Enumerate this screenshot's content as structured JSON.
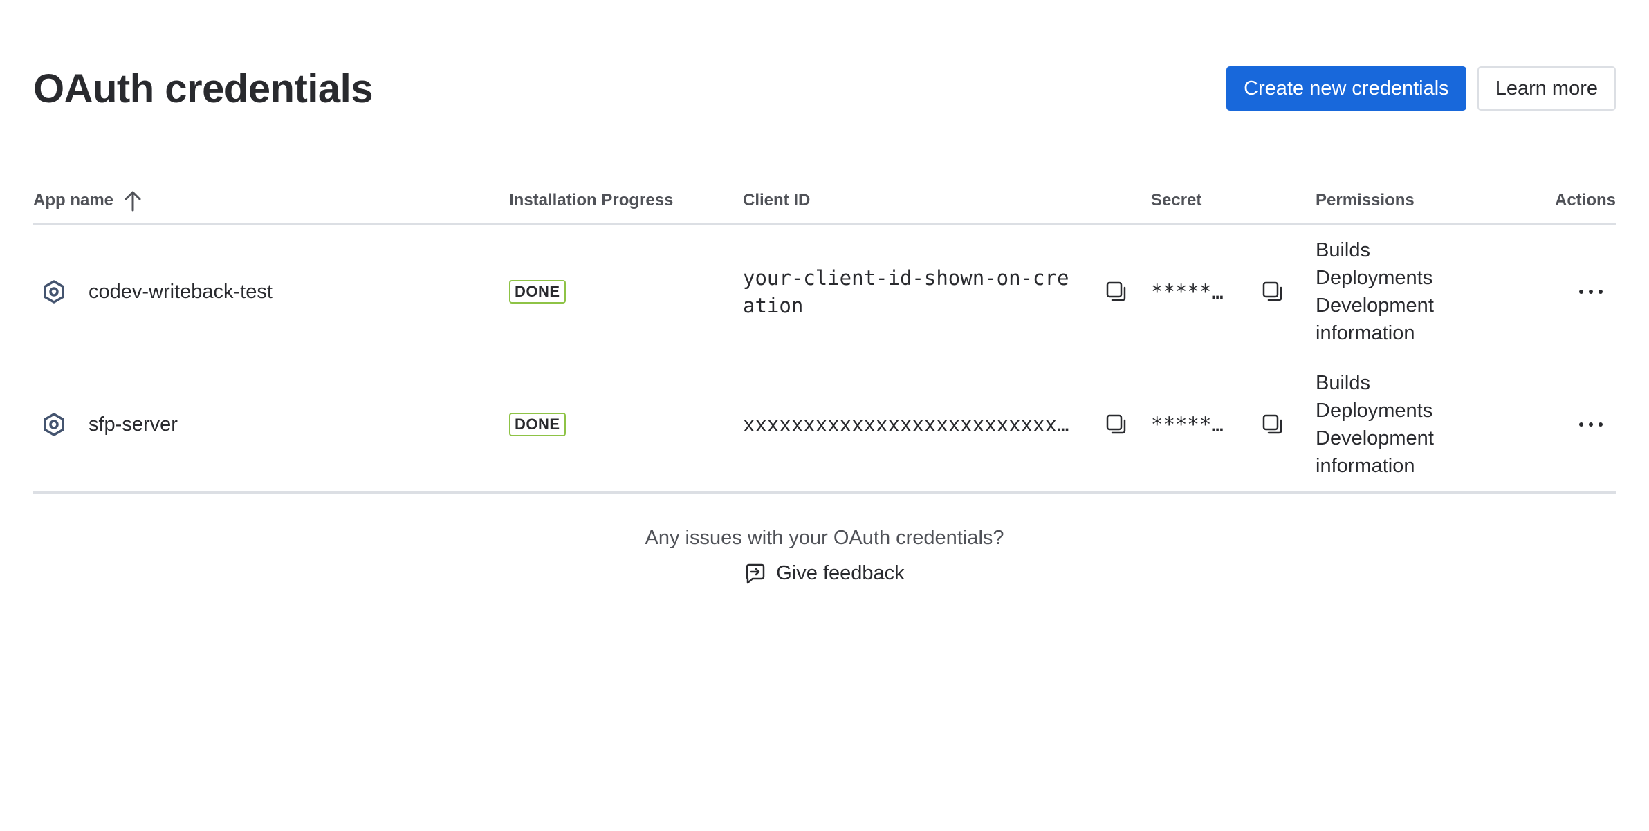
{
  "page": {
    "title": "OAuth credentials"
  },
  "header": {
    "create_label": "Create new credentials",
    "learn_label": "Learn more"
  },
  "table": {
    "columns": [
      "App name",
      "Installation Progress",
      "Client ID",
      "Secret",
      "Permissions",
      "Actions"
    ],
    "rows": [
      {
        "app_name": "codev-writeback-test",
        "progress": "DONE",
        "client_id": "your-client-id-shown-on-creation",
        "secret": "******…",
        "permissions": [
          "Builds",
          "Deployments",
          "Development",
          "information"
        ]
      },
      {
        "app_name": "sfp-server",
        "progress": "DONE",
        "client_id": "xxxxxxxxxxxxxxxxxxxxxxxxxxxxxxxxxxxx",
        "secret": "******…",
        "permissions": [
          "Builds",
          "Deployments",
          "Development",
          "information"
        ]
      }
    ]
  },
  "footer": {
    "question": "Any issues with your OAuth credentials?",
    "feedback_label": "Give feedback"
  },
  "colors": {
    "primary": "#1868db",
    "done_border": "#8ec346",
    "text": "#292a2e",
    "subtle": "#505258",
    "divider": "#dcdfe4"
  },
  "icons": {
    "sort": "arrow-up-icon",
    "app": "hexagon-app-icon",
    "copy": "copy-icon",
    "more": "more-horizontal-icon",
    "feedback": "feedback-icon"
  }
}
